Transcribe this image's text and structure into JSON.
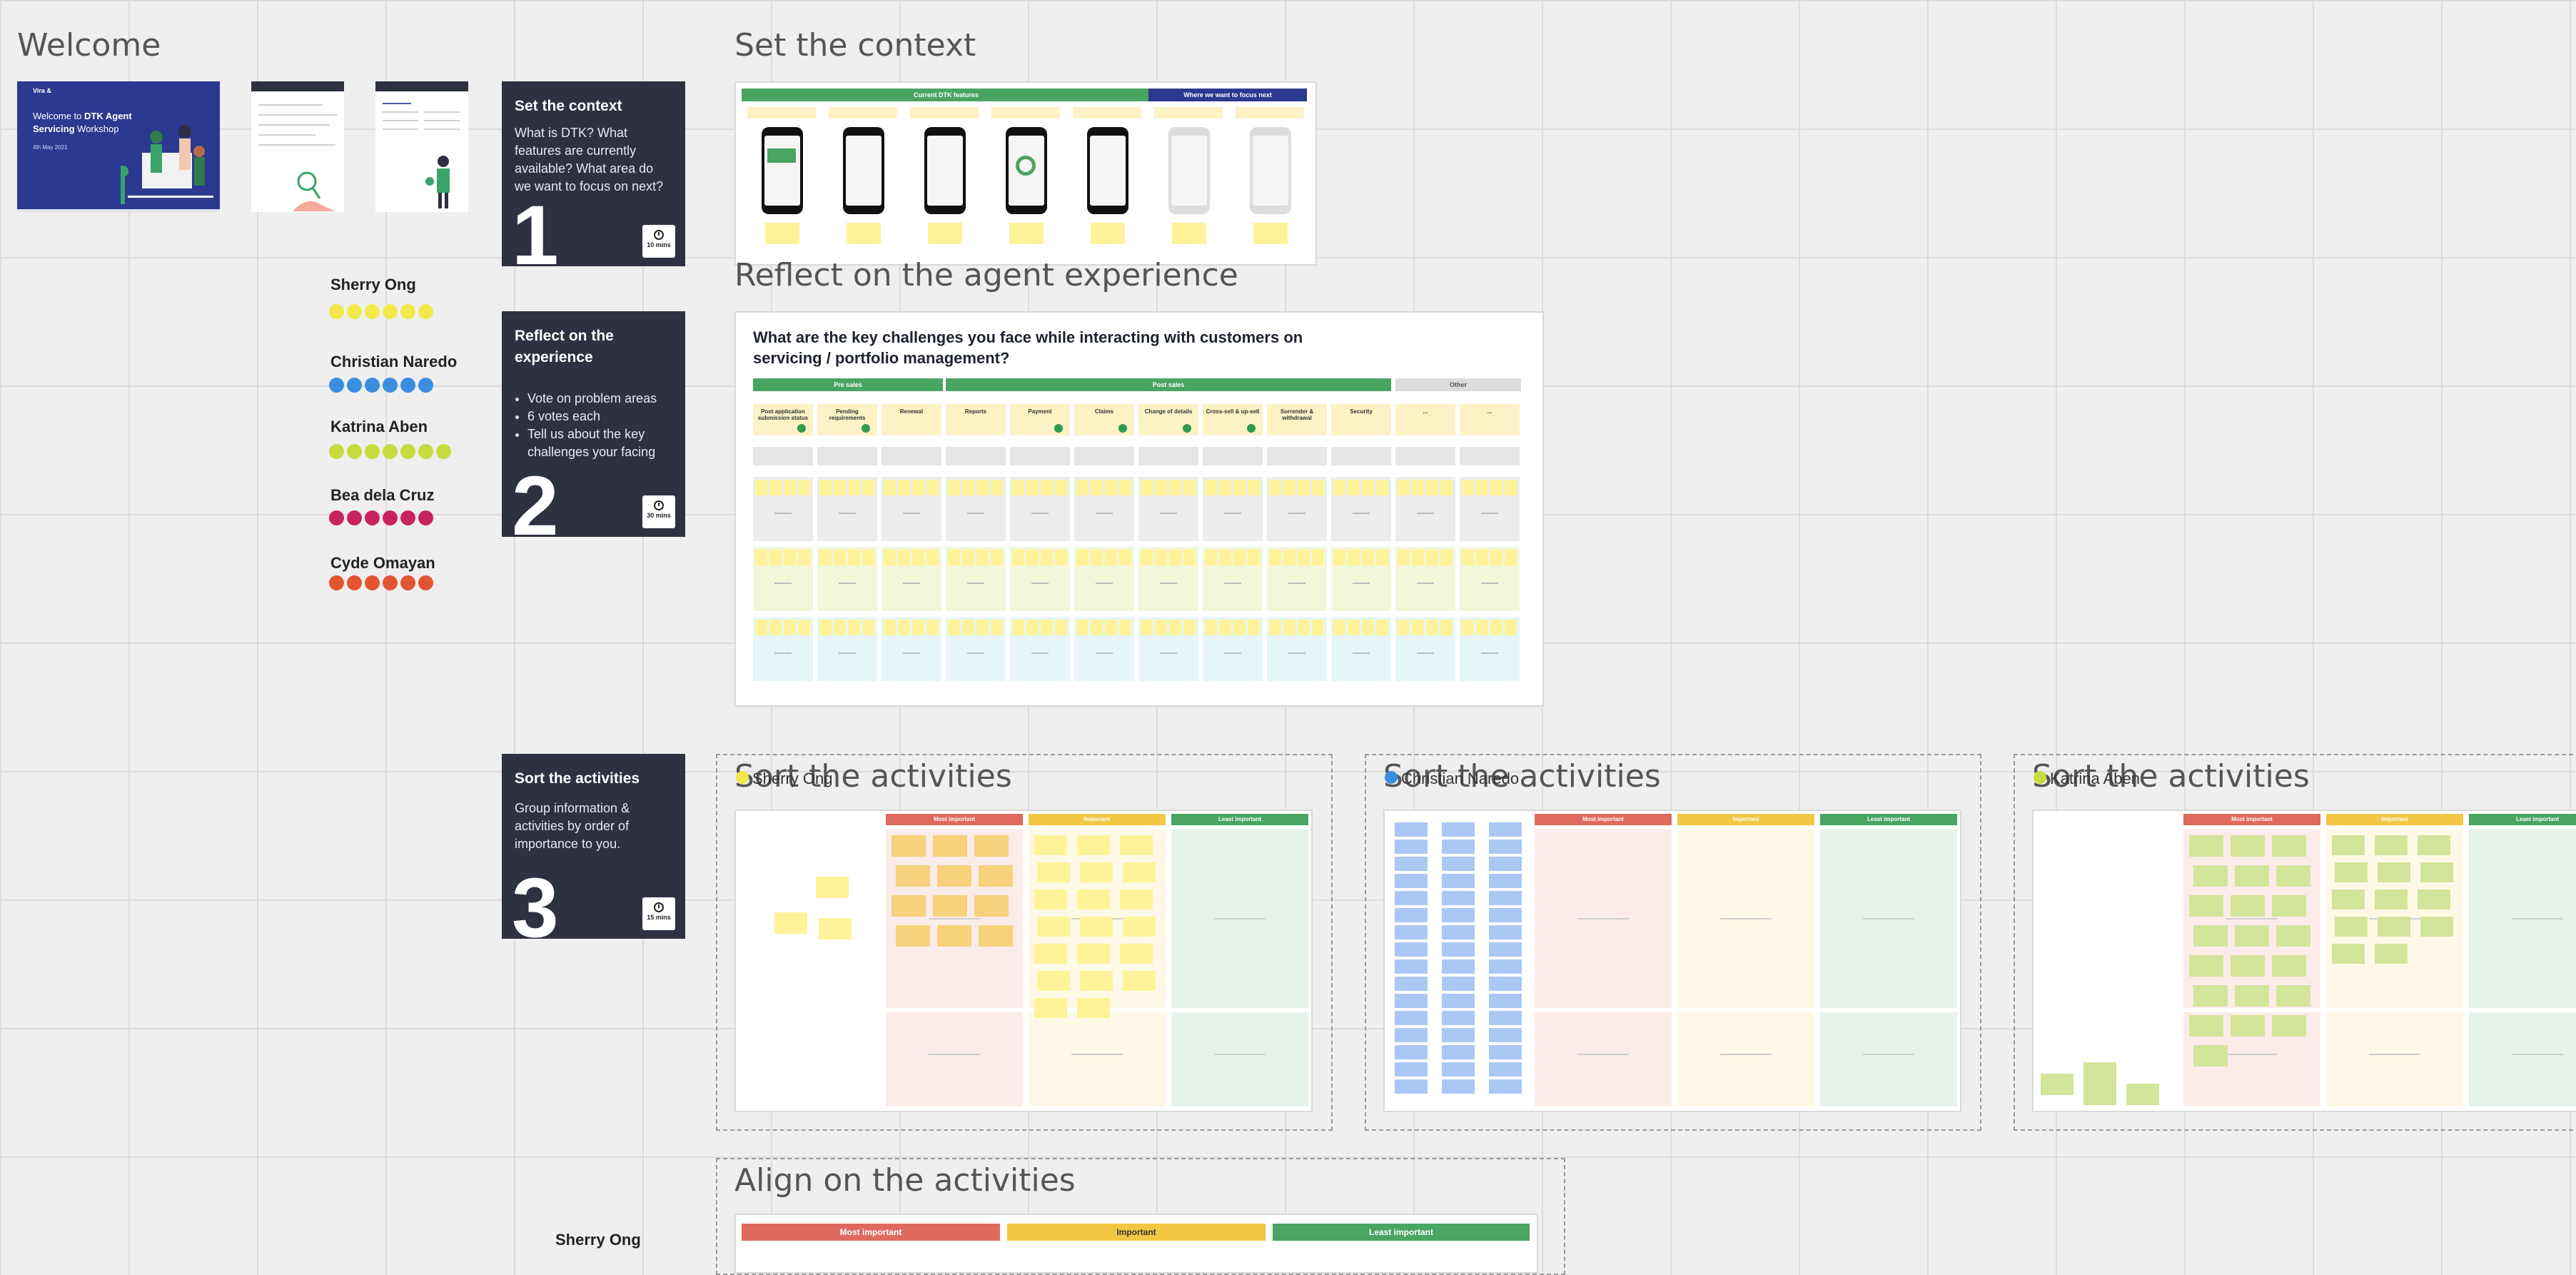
{
  "welcome": {
    "title": "Welcome",
    "slide_brand": "Vira &",
    "slide_title_pre": "Welcome to ",
    "slide_title_bold": "DTK Agent Servicing",
    "slide_title_post": "Workshop",
    "slide_date": "4th May 2021"
  },
  "cards": [
    {
      "title": "Set the context",
      "body": "What is DTK? What features are currently available? What area do we want to focus on next?",
      "number": "1",
      "time": "10 mins"
    },
    {
      "title": "Reflect on the experience",
      "bullets": [
        "Vote on problem areas",
        "6 votes each",
        "Tell us about the key challenges your facing"
      ],
      "number": "2",
      "time": "30 mins"
    },
    {
      "title": "Sort the activities",
      "body": "Group information & activities by order of importance to you.",
      "number": "3",
      "time": "15 mins"
    }
  ],
  "participants": [
    {
      "name": "Sherry Ong",
      "color": "#f3e84a",
      "votes": 6
    },
    {
      "name": "Christian Naredo",
      "color": "#3b8de0",
      "votes": 6
    },
    {
      "name": "Katrina Aben",
      "color": "#c7db3e",
      "votes": 7
    },
    {
      "name": "Bea dela Cruz",
      "color": "#c8235e",
      "votes": 6
    },
    {
      "name": "Cyde Omayan",
      "color": "#e25530",
      "votes": 6
    }
  ],
  "context": {
    "title": "Set the context",
    "header_left": "Current DTK features",
    "header_right": "Where we want to focus next"
  },
  "reflect": {
    "title": "Reflect on the agent experience",
    "question": "What are the key challenges you face while interacting with customers on servicing / portfolio management?",
    "group_left": "Pre sales",
    "group_mid": "Post sales",
    "group_right": "Other",
    "columns": [
      "Post application submission status",
      "Pending requirements",
      "Renewal",
      "Reports",
      "Payment",
      "Claims",
      "Change of details",
      "Cross-sell & up-sell",
      "Surrender & withdrawal",
      "Security",
      "...",
      "..."
    ]
  },
  "sort": {
    "title": "Sort the activities",
    "boards": [
      {
        "owner": "Sherry Ong",
        "owner_color": "#f3e84a"
      },
      {
        "owner": "Christian Naredo",
        "owner_color": "#3b8de0"
      },
      {
        "owner": "Katrina Aben",
        "owner_color": "#c7db3e"
      }
    ],
    "col_most": "Most important",
    "col_imp": "Important",
    "col_least": "Least important"
  },
  "align": {
    "title": "Align on the activities",
    "col_most": "Most important",
    "col_imp": "Important",
    "col_least": "Least important",
    "participant": "Sherry Ong"
  },
  "colors": {
    "dark_card": "#2e3140",
    "green": "#4aa462",
    "navy": "#2b3990",
    "red_head": "#e06a5e",
    "yellow_head": "#f2c744",
    "sticky_yellow": "#fff39a",
    "sticky_orange": "#f7d27c",
    "sticky_blue": "#aac8f3",
    "sticky_lime": "#d3e49b"
  }
}
